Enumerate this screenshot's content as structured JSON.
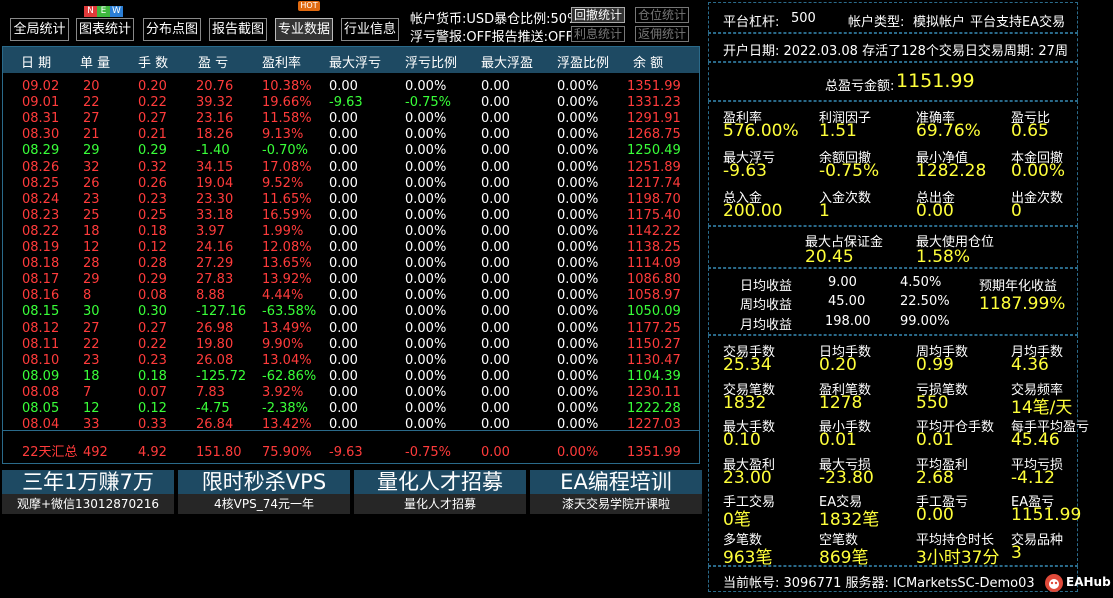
{
  "toolbar": {
    "buttons": [
      "全局统计",
      "图表统计",
      "分布点图",
      "报告截图",
      "专业数据",
      "行业信息"
    ],
    "new_badge": [
      "N",
      "E",
      "W"
    ],
    "hot_badge": "HOT",
    "info_line1": "帐户货币:USD暴仓比例:50%",
    "info_line2": "浮亏警报:OFF报告推送:OFF",
    "small_buttons": [
      "回撤统计",
      "仓位统计",
      "利息统计",
      "返佣统计"
    ]
  },
  "table": {
    "headers": [
      "日 期",
      "单 量",
      "手 数",
      "盈 亏",
      "盈利率",
      "最大浮亏",
      "浮亏比例",
      "最大浮盈",
      "浮盈比例",
      "余 额"
    ],
    "rows": [
      {
        "date": "09.02",
        "count": "20",
        "lots": "0.20",
        "pl": "20.76",
        "rate": "10.38%",
        "maxdd": "0.00",
        "ddpct": "0.00%",
        "maxfp": "0.00",
        "fppct": "0.00%",
        "bal": "1351.99",
        "c": "red"
      },
      {
        "date": "09.01",
        "count": "22",
        "lots": "0.22",
        "pl": "39.32",
        "rate": "19.66%",
        "maxdd": "-9.63",
        "ddpct": "-0.75%",
        "maxfp": "0.00",
        "fppct": "0.00%",
        "bal": "1331.23",
        "c": "red"
      },
      {
        "date": "08.31",
        "count": "27",
        "lots": "0.27",
        "pl": "23.16",
        "rate": "11.58%",
        "maxdd": "0.00",
        "ddpct": "0.00%",
        "maxfp": "0.00",
        "fppct": "0.00%",
        "bal": "1291.91",
        "c": "red"
      },
      {
        "date": "08.30",
        "count": "21",
        "lots": "0.21",
        "pl": "18.26",
        "rate": "9.13%",
        "maxdd": "0.00",
        "ddpct": "0.00%",
        "maxfp": "0.00",
        "fppct": "0.00%",
        "bal": "1268.75",
        "c": "red"
      },
      {
        "date": "08.29",
        "count": "29",
        "lots": "0.29",
        "pl": "-1.40",
        "rate": "-0.70%",
        "maxdd": "0.00",
        "ddpct": "0.00%",
        "maxfp": "0.00",
        "fppct": "0.00%",
        "bal": "1250.49",
        "c": "green"
      },
      {
        "date": "08.26",
        "count": "32",
        "lots": "0.32",
        "pl": "34.15",
        "rate": "17.08%",
        "maxdd": "0.00",
        "ddpct": "0.00%",
        "maxfp": "0.00",
        "fppct": "0.00%",
        "bal": "1251.89",
        "c": "red"
      },
      {
        "date": "08.25",
        "count": "26",
        "lots": "0.26",
        "pl": "19.04",
        "rate": "9.52%",
        "maxdd": "0.00",
        "ddpct": "0.00%",
        "maxfp": "0.00",
        "fppct": "0.00%",
        "bal": "1217.74",
        "c": "red"
      },
      {
        "date": "08.24",
        "count": "23",
        "lots": "0.23",
        "pl": "23.30",
        "rate": "11.65%",
        "maxdd": "0.00",
        "ddpct": "0.00%",
        "maxfp": "0.00",
        "fppct": "0.00%",
        "bal": "1198.70",
        "c": "red"
      },
      {
        "date": "08.23",
        "count": "25",
        "lots": "0.25",
        "pl": "33.18",
        "rate": "16.59%",
        "maxdd": "0.00",
        "ddpct": "0.00%",
        "maxfp": "0.00",
        "fppct": "0.00%",
        "bal": "1175.40",
        "c": "red"
      },
      {
        "date": "08.22",
        "count": "18",
        "lots": "0.18",
        "pl": "3.97",
        "rate": "1.99%",
        "maxdd": "0.00",
        "ddpct": "0.00%",
        "maxfp": "0.00",
        "fppct": "0.00%",
        "bal": "1142.22",
        "c": "red"
      },
      {
        "date": "08.19",
        "count": "12",
        "lots": "0.12",
        "pl": "24.16",
        "rate": "12.08%",
        "maxdd": "0.00",
        "ddpct": "0.00%",
        "maxfp": "0.00",
        "fppct": "0.00%",
        "bal": "1138.25",
        "c": "red"
      },
      {
        "date": "08.18",
        "count": "28",
        "lots": "0.28",
        "pl": "27.29",
        "rate": "13.65%",
        "maxdd": "0.00",
        "ddpct": "0.00%",
        "maxfp": "0.00",
        "fppct": "0.00%",
        "bal": "1114.09",
        "c": "red"
      },
      {
        "date": "08.17",
        "count": "29",
        "lots": "0.29",
        "pl": "27.83",
        "rate": "13.92%",
        "maxdd": "0.00",
        "ddpct": "0.00%",
        "maxfp": "0.00",
        "fppct": "0.00%",
        "bal": "1086.80",
        "c": "red"
      },
      {
        "date": "08.16",
        "count": "8",
        "lots": "0.08",
        "pl": "8.88",
        "rate": "4.44%",
        "maxdd": "0.00",
        "ddpct": "0.00%",
        "maxfp": "0.00",
        "fppct": "0.00%",
        "bal": "1058.97",
        "c": "red"
      },
      {
        "date": "08.15",
        "count": "30",
        "lots": "0.30",
        "pl": "-127.16",
        "rate": "-63.58%",
        "maxdd": "0.00",
        "ddpct": "0.00%",
        "maxfp": "0.00",
        "fppct": "0.00%",
        "bal": "1050.09",
        "c": "green"
      },
      {
        "date": "08.12",
        "count": "27",
        "lots": "0.27",
        "pl": "26.98",
        "rate": "13.49%",
        "maxdd": "0.00",
        "ddpct": "0.00%",
        "maxfp": "0.00",
        "fppct": "0.00%",
        "bal": "1177.25",
        "c": "red"
      },
      {
        "date": "08.11",
        "count": "22",
        "lots": "0.22",
        "pl": "19.80",
        "rate": "9.90%",
        "maxdd": "0.00",
        "ddpct": "0.00%",
        "maxfp": "0.00",
        "fppct": "0.00%",
        "bal": "1150.27",
        "c": "red"
      },
      {
        "date": "08.10",
        "count": "23",
        "lots": "0.23",
        "pl": "26.08",
        "rate": "13.04%",
        "maxdd": "0.00",
        "ddpct": "0.00%",
        "maxfp": "0.00",
        "fppct": "0.00%",
        "bal": "1130.47",
        "c": "red"
      },
      {
        "date": "08.09",
        "count": "18",
        "lots": "0.18",
        "pl": "-125.72",
        "rate": "-62.86%",
        "maxdd": "0.00",
        "ddpct": "0.00%",
        "maxfp": "0.00",
        "fppct": "0.00%",
        "bal": "1104.39",
        "c": "green"
      },
      {
        "date": "08.08",
        "count": "7",
        "lots": "0.07",
        "pl": "7.83",
        "rate": "3.92%",
        "maxdd": "0.00",
        "ddpct": "0.00%",
        "maxfp": "0.00",
        "fppct": "0.00%",
        "bal": "1230.11",
        "c": "red"
      },
      {
        "date": "08.05",
        "count": "12",
        "lots": "0.12",
        "pl": "-4.75",
        "rate": "-2.38%",
        "maxdd": "0.00",
        "ddpct": "0.00%",
        "maxfp": "0.00",
        "fppct": "0.00%",
        "bal": "1222.28",
        "c": "green"
      },
      {
        "date": "08.04",
        "count": "33",
        "lots": "0.33",
        "pl": "26.84",
        "rate": "13.42%",
        "maxdd": "0.00",
        "ddpct": "0.00%",
        "maxfp": "0.00",
        "fppct": "0.00%",
        "bal": "1227.03",
        "c": "red"
      }
    ],
    "summary": {
      "date": "22天汇总",
      "count": "492",
      "lots": "4.92",
      "pl": "151.80",
      "rate": "75.90%",
      "maxdd": "-9.63",
      "ddpct": "-0.75%",
      "maxfp": "0.00",
      "fppct": "0.00%",
      "bal": "1351.99"
    }
  },
  "promos": [
    {
      "title": "三年1万赚7万",
      "sub": "观摩+微信13012870216"
    },
    {
      "title": "限时秒杀VPS",
      "sub": "4核VPS_74元一年"
    },
    {
      "title": "量化人才招募",
      "sub": "量化人才招募"
    },
    {
      "title": "EA编程培训",
      "sub": "漆天交易学院开课啦"
    }
  ],
  "right": {
    "leverage_label": "平台杠杆:",
    "leverage": "500",
    "account_type_label": "帐户类型:",
    "account_type": "模拟帐户",
    "platform_ea": "平台支持EA交易",
    "open_date_line": "开户日期: 2022.03.08 存活了128个交易日交易周期: 27周",
    "total_pl_label": "总盈亏金额:",
    "total_pl": "1151.99",
    "stats1": [
      {
        "l": "盈利率",
        "v": "576.00%"
      },
      {
        "l": "利润因子",
        "v": "1.51"
      },
      {
        "l": "准确率",
        "v": "69.76%"
      },
      {
        "l": "盈亏比",
        "v": "0.65"
      },
      {
        "l": "最大浮亏",
        "v": "-9.63"
      },
      {
        "l": "余额回撤",
        "v": "-0.75%"
      },
      {
        "l": "最小净值",
        "v": "1282.28"
      },
      {
        "l": "本金回撤",
        "v": "0.00%"
      },
      {
        "l": "总入金",
        "v": "200.00"
      },
      {
        "l": "入金次数",
        "v": "1"
      },
      {
        "l": "总出金",
        "v": "0.00"
      },
      {
        "l": "出金次数",
        "v": "0"
      }
    ],
    "margin": [
      {
        "l": "最大占保证金",
        "v": "20.45"
      },
      {
        "l": "最大使用仓位",
        "v": "1.58%"
      }
    ],
    "returns": [
      {
        "l": "日均收益",
        "a": "9.00",
        "p": "4.50%"
      },
      {
        "l": "周均收益",
        "a": "45.00",
        "p": "22.50%"
      },
      {
        "l": "月均收益",
        "a": "198.00",
        "p": "99.00%"
      }
    ],
    "annual_label": "预期年化收益",
    "annual": "1187.99%",
    "stats2": [
      {
        "l": "交易手数",
        "v": "25.34"
      },
      {
        "l": "日均手数",
        "v": "0.20"
      },
      {
        "l": "周均手数",
        "v": "0.99"
      },
      {
        "l": "月均手数",
        "v": "4.36"
      },
      {
        "l": "交易笔数",
        "v": "1832"
      },
      {
        "l": "盈利笔数",
        "v": "1278"
      },
      {
        "l": "亏损笔数",
        "v": "550"
      },
      {
        "l": "交易频率",
        "v": "14笔/天"
      },
      {
        "l": "最大手数",
        "v": "0.10"
      },
      {
        "l": "最小手数",
        "v": "0.01"
      },
      {
        "l": "平均开仓手数",
        "v": "0.01"
      },
      {
        "l": "每手平均盈亏",
        "v": "45.46"
      },
      {
        "l": "最大盈利",
        "v": "23.00"
      },
      {
        "l": "最大亏损",
        "v": "-23.80"
      },
      {
        "l": "平均盈利",
        "v": "2.68"
      },
      {
        "l": "平均亏损",
        "v": "-4.12"
      },
      {
        "l": "手工交易",
        "v": "0笔"
      },
      {
        "l": "EA交易",
        "v": "1832笔"
      },
      {
        "l": "手工盈亏",
        "v": "0.00"
      },
      {
        "l": "EA盈亏",
        "v": "1151.99"
      },
      {
        "l": "多笔数",
        "v": "963笔"
      },
      {
        "l": "空笔数",
        "v": "869笔"
      },
      {
        "l": "平均持仓时长",
        "v": "3小时37分"
      },
      {
        "l": "交易品种",
        "v": "3"
      }
    ],
    "footer": "当前帐号: 3096771 服务器: ICMarketsSC-Demo03",
    "brand": "EAHub"
  },
  "colors": {
    "header_bg": "#1e4a63",
    "border": "#2a6a8a",
    "profit": "#ff3b3b",
    "loss": "#39ff39",
    "value": "#ffff3b"
  }
}
